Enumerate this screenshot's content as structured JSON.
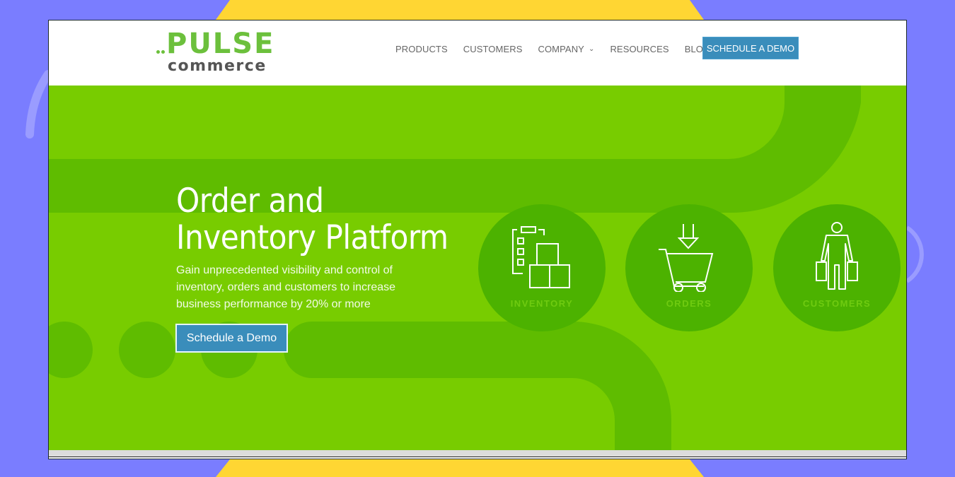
{
  "brand": {
    "name_primary": "PULSE",
    "name_secondary": "commerce",
    "accent_green": "#78cc00",
    "accent_blue": "#3a8dbb"
  },
  "nav": {
    "items": [
      {
        "label": "PRODUCTS",
        "has_dropdown": false
      },
      {
        "label": "CUSTOMERS",
        "has_dropdown": false
      },
      {
        "label": "COMPANY",
        "has_dropdown": true
      },
      {
        "label": "RESOURCES",
        "has_dropdown": false
      },
      {
        "label": "BLOG",
        "has_dropdown": false
      }
    ],
    "cta_label": "SCHEDULE A DEMO"
  },
  "hero": {
    "title_line1": "Order and",
    "title_line2": "Inventory Platform",
    "subtitle": "Gain unprecedented visibility and control of inventory, orders and customers to increase business performance by 20% or more",
    "cta_label": "Schedule a Demo",
    "features": [
      {
        "label": "INVENTORY",
        "icon": "inventory-boxes-icon"
      },
      {
        "label": "ORDERS",
        "icon": "shopping-cart-icon"
      },
      {
        "label": "CUSTOMERS",
        "icon": "shopper-person-icon"
      }
    ]
  }
}
